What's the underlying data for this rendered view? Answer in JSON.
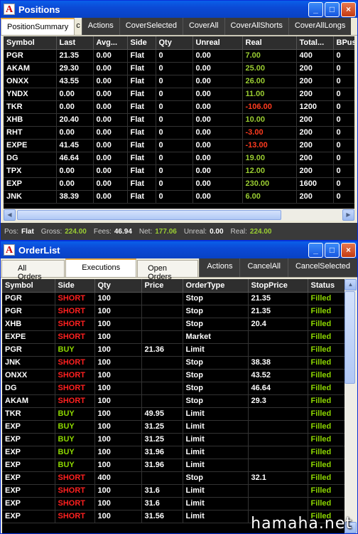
{
  "positions": {
    "title": "Positions",
    "tab_active": "PositionSummary",
    "menu": [
      "Actions",
      "CoverSelected",
      "CoverAll",
      "CoverAllShorts",
      "CoverAllLongs"
    ],
    "columns": [
      "Symbol",
      "Last",
      "Avg...",
      "Side",
      "Qty",
      "Unreal",
      "Real",
      "Total...",
      "BPus"
    ],
    "rows": [
      {
        "symbol": "PGR",
        "last": "21.35",
        "avg": "0.00",
        "side": "Flat",
        "qty": "0",
        "unreal": "0.00",
        "real": "7.00",
        "real_sign": "pos",
        "total": "400",
        "bp": "0"
      },
      {
        "symbol": "AKAM",
        "last": "29.30",
        "avg": "0.00",
        "side": "Flat",
        "qty": "0",
        "unreal": "0.00",
        "real": "25.00",
        "real_sign": "pos",
        "total": "200",
        "bp": "0"
      },
      {
        "symbol": "ONXX",
        "last": "43.55",
        "avg": "0.00",
        "side": "Flat",
        "qty": "0",
        "unreal": "0.00",
        "real": "26.00",
        "real_sign": "pos",
        "total": "200",
        "bp": "0"
      },
      {
        "symbol": "YNDX",
        "last": "0.00",
        "avg": "0.00",
        "side": "Flat",
        "qty": "0",
        "unreal": "0.00",
        "real": "11.00",
        "real_sign": "pos",
        "total": "200",
        "bp": "0"
      },
      {
        "symbol": "TKR",
        "last": "0.00",
        "avg": "0.00",
        "side": "Flat",
        "qty": "0",
        "unreal": "0.00",
        "real": "-106.00",
        "real_sign": "neg",
        "total": "1200",
        "bp": "0"
      },
      {
        "symbol": "XHB",
        "last": "20.40",
        "avg": "0.00",
        "side": "Flat",
        "qty": "0",
        "unreal": "0.00",
        "real": "10.00",
        "real_sign": "pos",
        "total": "200",
        "bp": "0"
      },
      {
        "symbol": "RHT",
        "last": "0.00",
        "avg": "0.00",
        "side": "Flat",
        "qty": "0",
        "unreal": "0.00",
        "real": "-3.00",
        "real_sign": "neg",
        "total": "200",
        "bp": "0"
      },
      {
        "symbol": "EXPE",
        "last": "41.45",
        "avg": "0.00",
        "side": "Flat",
        "qty": "0",
        "unreal": "0.00",
        "real": "-13.00",
        "real_sign": "neg",
        "total": "200",
        "bp": "0"
      },
      {
        "symbol": "DG",
        "last": "46.64",
        "avg": "0.00",
        "side": "Flat",
        "qty": "0",
        "unreal": "0.00",
        "real": "19.00",
        "real_sign": "pos",
        "total": "200",
        "bp": "0"
      },
      {
        "symbol": "TPX",
        "last": "0.00",
        "avg": "0.00",
        "side": "Flat",
        "qty": "0",
        "unreal": "0.00",
        "real": "12.00",
        "real_sign": "pos",
        "total": "200",
        "bp": "0"
      },
      {
        "symbol": "EXP",
        "last": "0.00",
        "avg": "0.00",
        "side": "Flat",
        "qty": "0",
        "unreal": "0.00",
        "real": "230.00",
        "real_sign": "pos",
        "total": "1600",
        "bp": "0"
      },
      {
        "symbol": "JNK",
        "last": "38.39",
        "avg": "0.00",
        "side": "Flat",
        "qty": "0",
        "unreal": "0.00",
        "real": "6.00",
        "real_sign": "pos",
        "total": "200",
        "bp": "0"
      }
    ],
    "status": {
      "pos_label": "Pos:",
      "pos_value": "Flat",
      "gross_label": "Gross:",
      "gross_value": "224.00",
      "fees_label": "Fees:",
      "fees_value": "46.94",
      "net_label": "Net:",
      "net_value": "177.06",
      "unreal_label": "Unreal:",
      "unreal_value": "0.00",
      "real_label": "Real:",
      "real_value": "224.00"
    }
  },
  "orders": {
    "title": "OrderList",
    "tabs": [
      "All Orders",
      "Executions",
      "Open Orders"
    ],
    "menu": [
      "Actions",
      "CancelAll",
      "CancelSelected"
    ],
    "columns": [
      "Symbol",
      "Side",
      "Qty",
      "Price",
      "OrderType",
      "StopPrice",
      "Status"
    ],
    "rows": [
      {
        "symbol": "PGR",
        "side": "SHORT",
        "qty": "100",
        "price": "",
        "type": "Stop",
        "stop": "21.35",
        "status": "Filled"
      },
      {
        "symbol": "PGR",
        "side": "SHORT",
        "qty": "100",
        "price": "",
        "type": "Stop",
        "stop": "21.35",
        "status": "Filled"
      },
      {
        "symbol": "XHB",
        "side": "SHORT",
        "qty": "100",
        "price": "",
        "type": "Stop",
        "stop": "20.4",
        "status": "Filled"
      },
      {
        "symbol": "EXPE",
        "side": "SHORT",
        "qty": "100",
        "price": "",
        "type": "Market",
        "stop": "",
        "status": "Filled"
      },
      {
        "symbol": "PGR",
        "side": "BUY",
        "qty": "100",
        "price": "21.36",
        "type": "Limit",
        "stop": "",
        "status": "Filled"
      },
      {
        "symbol": "JNK",
        "side": "SHORT",
        "qty": "100",
        "price": "",
        "type": "Stop",
        "stop": "38.38",
        "status": "Filled"
      },
      {
        "symbol": "ONXX",
        "side": "SHORT",
        "qty": "100",
        "price": "",
        "type": "Stop",
        "stop": "43.52",
        "status": "Filled"
      },
      {
        "symbol": "DG",
        "side": "SHORT",
        "qty": "100",
        "price": "",
        "type": "Stop",
        "stop": "46.64",
        "status": "Filled"
      },
      {
        "symbol": "AKAM",
        "side": "SHORT",
        "qty": "100",
        "price": "",
        "type": "Stop",
        "stop": "29.3",
        "status": "Filled"
      },
      {
        "symbol": "TKR",
        "side": "BUY",
        "qty": "100",
        "price": "49.95",
        "type": "Limit",
        "stop": "",
        "status": "Filled"
      },
      {
        "symbol": "EXP",
        "side": "BUY",
        "qty": "100",
        "price": "31.25",
        "type": "Limit",
        "stop": "",
        "status": "Filled"
      },
      {
        "symbol": "EXP",
        "side": "BUY",
        "qty": "100",
        "price": "31.25",
        "type": "Limit",
        "stop": "",
        "status": "Filled"
      },
      {
        "symbol": "EXP",
        "side": "BUY",
        "qty": "100",
        "price": "31.96",
        "type": "Limit",
        "stop": "",
        "status": "Filled"
      },
      {
        "symbol": "EXP",
        "side": "BUY",
        "qty": "100",
        "price": "31.96",
        "type": "Limit",
        "stop": "",
        "status": "Filled"
      },
      {
        "symbol": "EXP",
        "side": "SHORT",
        "qty": "400",
        "price": "",
        "type": "Stop",
        "stop": "32.1",
        "status": "Filled"
      },
      {
        "symbol": "EXP",
        "side": "SHORT",
        "qty": "100",
        "price": "31.6",
        "type": "Limit",
        "stop": "",
        "status": "Filled"
      },
      {
        "symbol": "EXP",
        "side": "SHORT",
        "qty": "100",
        "price": "31.6",
        "type": "Limit",
        "stop": "",
        "status": "Filled"
      },
      {
        "symbol": "EXP",
        "side": "SHORT",
        "qty": "100",
        "price": "31.56",
        "type": "Limit",
        "stop": "",
        "status": "Filled"
      }
    ]
  },
  "watermark": "hamaha.net",
  "colors": {
    "positive": "#9acd32",
    "negative": "#ff3b1f",
    "short": "#ff2020",
    "buy": "#8cd600"
  }
}
